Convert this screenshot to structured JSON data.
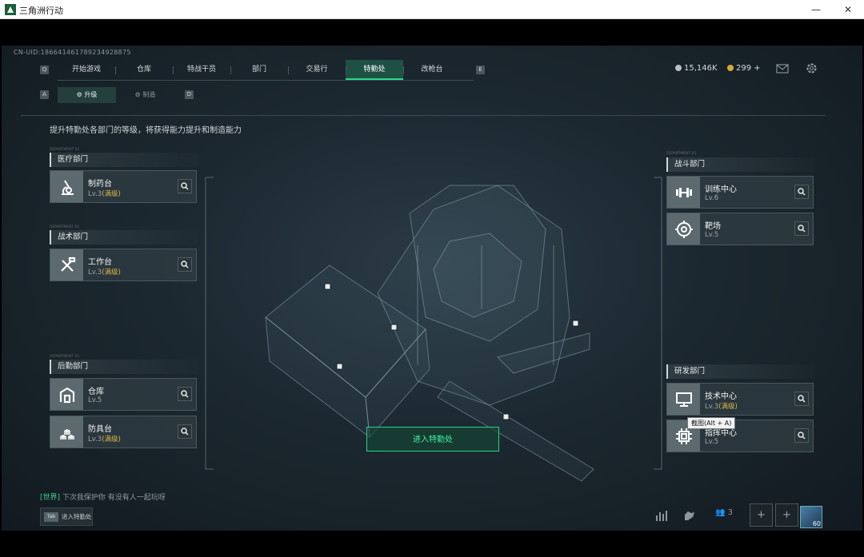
{
  "window": {
    "title": "三角洲行动",
    "min": "—",
    "max": "☐",
    "close": "✕"
  },
  "uid": "CN-UID:186641461789234928875",
  "nav": {
    "left_key": "Q",
    "right_key": "E",
    "tabs": [
      {
        "label": "开始游戏",
        "active": false
      },
      {
        "label": "仓库",
        "active": false
      },
      {
        "label": "特战干员",
        "active": false
      },
      {
        "label": "部门",
        "active": false
      },
      {
        "label": "交易行",
        "active": false
      },
      {
        "label": "特勤处",
        "active": true
      },
      {
        "label": "改枪台",
        "active": false
      }
    ]
  },
  "sub_nav": {
    "left_key": "A",
    "right_key": "D",
    "tabs": [
      {
        "label": "升级",
        "active": true
      },
      {
        "label": "制造",
        "active": false
      }
    ]
  },
  "currency": {
    "silver": "15,146K",
    "gold": "299",
    "gold_plus": "+"
  },
  "description": "提升特勤处各部门的等级，将获得能力提升和制造能力",
  "dept_tiny_label": "DEPARTMENT 01",
  "departments": {
    "medical": {
      "title": "医疗部门",
      "items": [
        {
          "name": "制药台",
          "lv": "Lv.3",
          "max": "(满级)",
          "icon": "microscope-icon"
        }
      ]
    },
    "tactical": {
      "title": "战术部门",
      "items": [
        {
          "name": "工作台",
          "lv": "Lv.3",
          "max": "(满级)",
          "icon": "tools-icon"
        }
      ]
    },
    "logistics": {
      "title": "后勤部门",
      "items": [
        {
          "name": "仓库",
          "lv": "Lv.5",
          "max": "",
          "icon": "warehouse-icon"
        },
        {
          "name": "防具台",
          "lv": "Lv.3",
          "max": "(满级)",
          "icon": "cubes-icon"
        }
      ]
    },
    "combat": {
      "title": "战斗部门",
      "items": [
        {
          "name": "训练中心",
          "lv": "Lv.6",
          "max": "",
          "icon": "dumbbell-icon"
        },
        {
          "name": "靶场",
          "lv": "Lv.5",
          "max": "",
          "icon": "target-icon"
        }
      ]
    },
    "research": {
      "title": "研发部门",
      "items": [
        {
          "name": "技术中心",
          "lv": "Lv.3",
          "max": "(满级)",
          "icon": "computer-icon"
        },
        {
          "name": "指挥中心",
          "lv": "Lv.5",
          "max": "",
          "icon": "chip-icon"
        }
      ]
    }
  },
  "enter_button": "进入特勤处",
  "chat": {
    "tag": "[世界]",
    "text": "下次我保护你 有没有人一起玩呀"
  },
  "tab_hint": {
    "key": "Tab",
    "label": "进入特勤处"
  },
  "bottom": {
    "friends_count": "3",
    "add": "+",
    "level": "60"
  },
  "tooltip": "截图(Alt + A)",
  "colors": {
    "accent_green": "#29d98a",
    "max_level_gold": "#d9b54a",
    "panel": "#303c42"
  }
}
